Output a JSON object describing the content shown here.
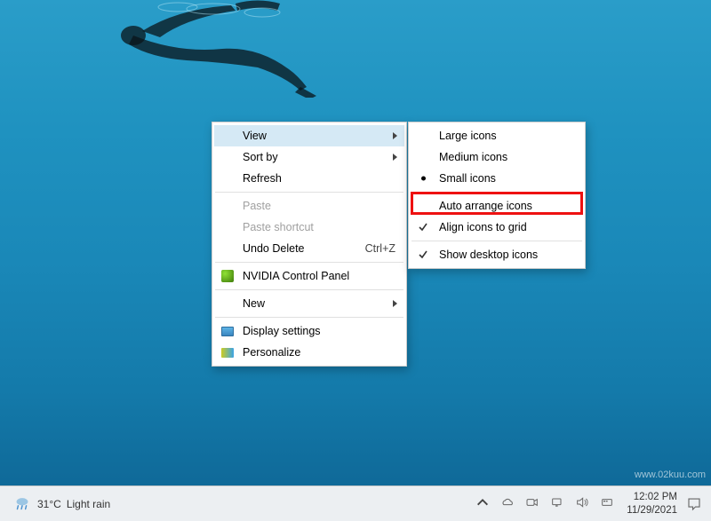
{
  "context_menu_main": {
    "view": "View",
    "sort_by": "Sort by",
    "refresh": "Refresh",
    "paste": "Paste",
    "paste_shortcut": "Paste shortcut",
    "undo_delete": "Undo Delete",
    "undo_delete_shortcut": "Ctrl+Z",
    "nvidia": "NVIDIA Control Panel",
    "new": "New",
    "display_settings": "Display settings",
    "personalize": "Personalize"
  },
  "context_menu_view": {
    "large_icons": "Large icons",
    "medium_icons": "Medium icons",
    "small_icons": "Small icons",
    "auto_arrange": "Auto arrange icons",
    "align_grid": "Align icons to grid",
    "show_desktop": "Show desktop icons"
  },
  "taskbar": {
    "temp": "31°C",
    "weather": "Light rain",
    "time": "12:02 PM",
    "date": "11/29/2021"
  },
  "watermark": "www.02kuu.com"
}
